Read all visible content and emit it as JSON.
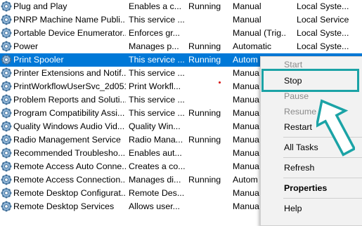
{
  "services": [
    {
      "name": "Plug and Play",
      "description": "Enables a c...",
      "status": "Running",
      "startup": "Manual",
      "logon": "Local Syste..."
    },
    {
      "name": "PNRP Machine Name Publi...",
      "description": "This service ...",
      "status": "",
      "startup": "Manual",
      "logon": "Local Service"
    },
    {
      "name": "Portable Device Enumerator...",
      "description": "Enforces gr...",
      "status": "",
      "startup": "Manual (Trig...",
      "logon": "Local Syste..."
    },
    {
      "name": "Power",
      "description": "Manages p...",
      "status": "Running",
      "startup": "Automatic",
      "logon": "Local Syste..."
    },
    {
      "name": "Print Spooler",
      "description": "This service ...",
      "status": "Running",
      "startup": "Autom",
      "logon": ""
    },
    {
      "name": "Printer Extensions and Notif...",
      "description": "This service ...",
      "status": "",
      "startup": "Manua",
      "logon": ""
    },
    {
      "name": "PrintWorkflowUserSvc_2d051",
      "description": "Print Workfl...",
      "status": "",
      "startup": "Manua",
      "logon": ""
    },
    {
      "name": "Problem Reports and Soluti...",
      "description": "This service ...",
      "status": "",
      "startup": "Manua",
      "logon": ""
    },
    {
      "name": "Program Compatibility Assi...",
      "description": "This service ...",
      "status": "Running",
      "startup": "Manua",
      "logon": ""
    },
    {
      "name": "Quality Windows Audio Vid...",
      "description": "Quality Win...",
      "status": "",
      "startup": "Manua",
      "logon": ""
    },
    {
      "name": "Radio Management Service",
      "description": "Radio Mana...",
      "status": "Running",
      "startup": "Manua",
      "logon": ""
    },
    {
      "name": "Recommended Troublesho...",
      "description": "Enables aut...",
      "status": "",
      "startup": "Manua",
      "logon": ""
    },
    {
      "name": "Remote Access Auto Conne...",
      "description": "Creates a co...",
      "status": "",
      "startup": "Manua",
      "logon": ""
    },
    {
      "name": "Remote Access Connection...",
      "description": "Manages di...",
      "status": "Running",
      "startup": "Autom",
      "logon": ""
    },
    {
      "name": "Remote Desktop Configurat...",
      "description": "Remote Des...",
      "status": "",
      "startup": "Manua",
      "logon": ""
    },
    {
      "name": "Remote Desktop Services",
      "description": "Allows user...",
      "status": "",
      "startup": "Manua",
      "logon": ""
    }
  ],
  "context_menu": {
    "start": "Start",
    "stop": "Stop",
    "pause": "Pause",
    "resume": "Resume",
    "restart": "Restart",
    "all_tasks": "All Tasks",
    "refresh": "Refresh",
    "properties": "Properties",
    "help": "Help",
    "submenu_arrow": ">"
  },
  "colors": {
    "selection": "#0078d7",
    "highlight_box": "#1ba3a6",
    "menu_background": "#f2f2f2"
  },
  "icons": {
    "service": "gear-icon",
    "callout": "up-arrow-icon"
  }
}
